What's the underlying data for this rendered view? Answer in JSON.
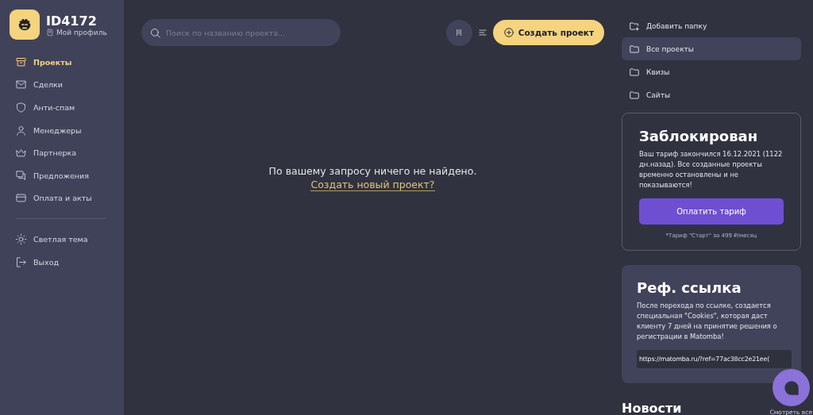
{
  "profile": {
    "id": "ID4172",
    "link": "Мой профиль"
  },
  "nav": [
    {
      "label": "Проекты",
      "selected": true
    },
    {
      "label": "Сделки",
      "selected": false
    },
    {
      "label": "Анти-спам",
      "selected": false
    },
    {
      "label": "Менеджеры",
      "selected": false
    },
    {
      "label": "Партнерка",
      "selected": false
    },
    {
      "label": "Предложения",
      "selected": false
    },
    {
      "label": "Оплата и акты",
      "selected": false
    }
  ],
  "nav_bottom": [
    {
      "label": "Светлая тема"
    },
    {
      "label": "Выход"
    }
  ],
  "search": {
    "placeholder": "Поиск по названию проекта..."
  },
  "create_button": "Создать проект",
  "empty": {
    "message": "По вашему запросу ничего не найдено.",
    "link": "Создать новый проект?"
  },
  "folders": [
    {
      "label": "Добавить папку",
      "kind": "add",
      "selected": false
    },
    {
      "label": "Все проекты",
      "kind": "folder",
      "selected": true
    },
    {
      "label": "Квизы",
      "kind": "folder",
      "selected": false
    },
    {
      "label": "Сайты",
      "kind": "folder",
      "selected": false
    }
  ],
  "blocked": {
    "title": "Заблокирован",
    "text": "Ваш тариф закончился 16.12.2021 (1122 дн.назад). Все созданные проекты временно остановлены и не показываются!",
    "button": "Оплатить тариф",
    "note": "*Тариф \"Старт\" за 499 ₽/месяц"
  },
  "referral": {
    "title": "Реф. ссылка",
    "text": "После перехода по ссылке, создается специальная \"Cookies\", которая даст клиенту 7 дней на принятие решения о регистрации в Matomba!",
    "value": "https://matomba.ru/?ref=77ac38cc2e21ee("
  },
  "news": {
    "title": "Новости",
    "link": "Смотреть все"
  }
}
